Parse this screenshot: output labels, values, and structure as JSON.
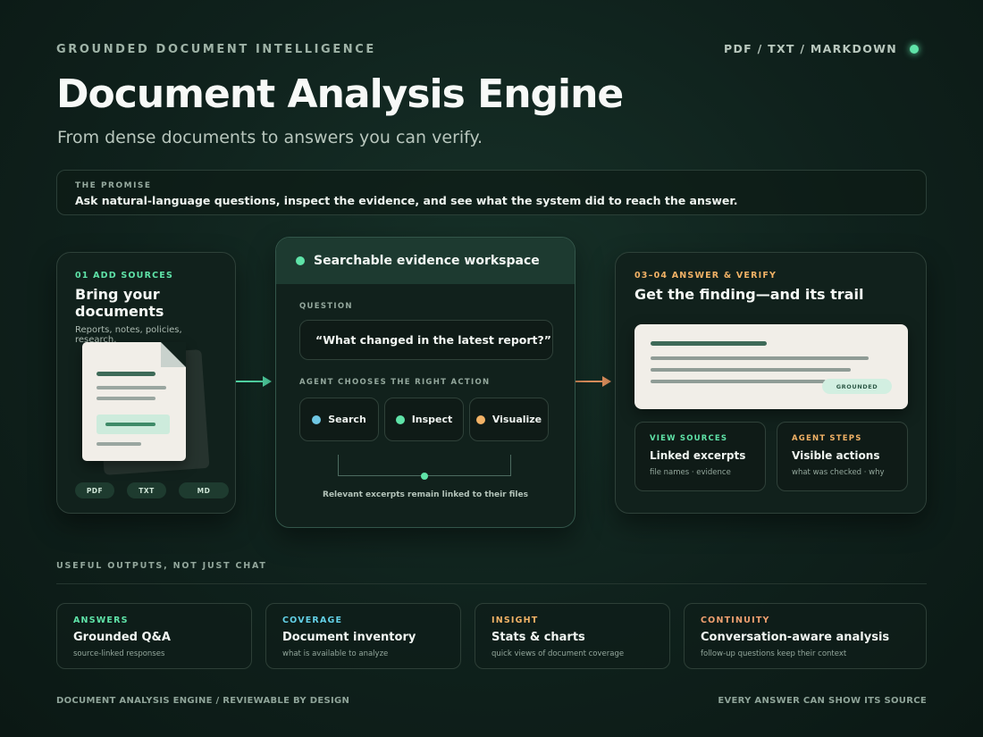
{
  "header": {
    "kicker": "GROUNDED DOCUMENT INTELLIGENCE",
    "formats": "PDF / TXT / MARKDOWN",
    "title": "Document Analysis Engine",
    "subtitle": "From dense documents to answers you can verify."
  },
  "promise": {
    "label": "THE PROMISE",
    "text": "Ask natural-language questions, inspect the evidence, and see what the system did to reach the answer."
  },
  "sources": {
    "step": "01 ADD SOURCES",
    "title": "Bring your documents",
    "subtitle": "Reports, notes, policies, research.",
    "pills": [
      "PDF",
      "TXT",
      "MD"
    ]
  },
  "workspace": {
    "title": "Searchable evidence workspace",
    "question_label": "QUESTION",
    "question": "“What changed in the latest report?”",
    "actions_label": "AGENT CHOOSES THE RIGHT ACTION",
    "actions": [
      {
        "label": "Search",
        "color": "#6fc7e3"
      },
      {
        "label": "Inspect",
        "color": "#5fe3a8"
      },
      {
        "label": "Visualize",
        "color": "#f2b266"
      }
    ],
    "linked_note": "Relevant excerpts remain linked to their files"
  },
  "answer": {
    "step": "03–04 ANSWER & VERIFY",
    "title": "Get the finding—and its trail",
    "badge": "GROUNDED",
    "view_sources": {
      "label": "VIEW SOURCES",
      "title": "Linked excerpts",
      "sub": "file names · evidence"
    },
    "agent_steps": {
      "label": "AGENT STEPS",
      "title": "Visible actions",
      "sub": "what was checked · why"
    }
  },
  "outputs": {
    "label": "USEFUL OUTPUTS, NOT JUST CHAT",
    "cards": [
      {
        "tag": "ANSWERS",
        "title": "Grounded Q&A",
        "sub": "source-linked responses",
        "color": "#5fe3a8"
      },
      {
        "tag": "COVERAGE",
        "title": "Document inventory",
        "sub": "what is available to analyze",
        "color": "#63d0e6"
      },
      {
        "tag": "INSIGHT",
        "title": "Stats & charts",
        "sub": "quick views of document coverage",
        "color": "#f2b266"
      },
      {
        "tag": "CONTINUITY",
        "title": "Conversation-aware analysis",
        "sub": "follow-up questions keep their context",
        "color": "#f0a070"
      }
    ]
  },
  "footer": {
    "left": "DOCUMENT ANALYSIS ENGINE / REVIEWABLE BY DESIGN",
    "right": "EVERY ANSWER CAN SHOW ITS SOURCE"
  },
  "colors": {
    "accent_green": "#5fe3a8",
    "accent_orange": "#f2b266",
    "background": "#0f211c"
  }
}
